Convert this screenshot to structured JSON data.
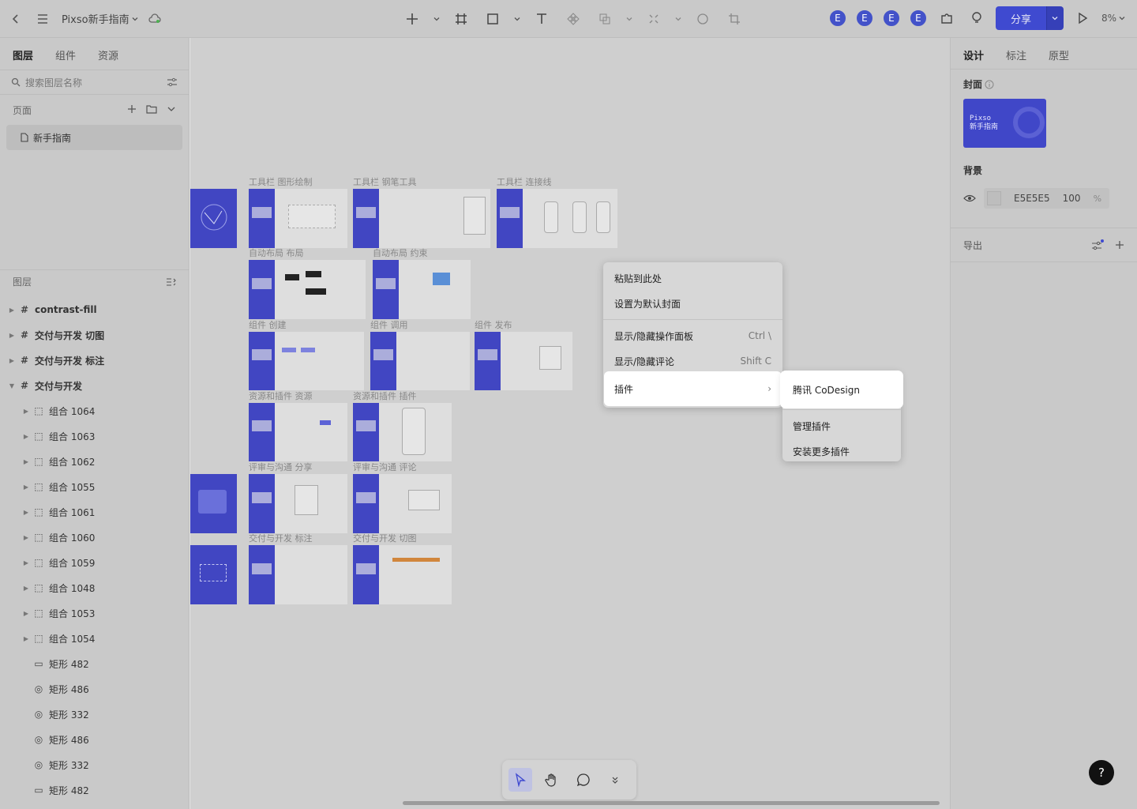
{
  "topbar": {
    "file_title": "Pixso新手指南",
    "avatars": [
      "E",
      "E",
      "E",
      "E"
    ],
    "share_label": "分享",
    "zoom": "8%"
  },
  "left": {
    "tabs": [
      "图层",
      "组件",
      "资源"
    ],
    "search_placeholder": "搜索图层名称",
    "pages_title": "页面",
    "page_item": "新手指南",
    "layers_title": "图层",
    "layers": [
      {
        "label": "contrast-fill",
        "level": 0,
        "kind": "frame"
      },
      {
        "label": "交付与开发 切图",
        "level": 0,
        "kind": "frame"
      },
      {
        "label": "交付与开发 标注",
        "level": 0,
        "kind": "frame"
      },
      {
        "label": "交付与开发",
        "level": 0,
        "kind": "frame",
        "open": true
      },
      {
        "label": "组合 1064",
        "level": 1,
        "kind": "group"
      },
      {
        "label": "组合 1063",
        "level": 1,
        "kind": "group"
      },
      {
        "label": "组合 1062",
        "level": 1,
        "kind": "group"
      },
      {
        "label": "组合 1055",
        "level": 1,
        "kind": "group"
      },
      {
        "label": "组合 1061",
        "level": 1,
        "kind": "group"
      },
      {
        "label": "组合 1060",
        "level": 1,
        "kind": "group"
      },
      {
        "label": "组合 1059",
        "level": 1,
        "kind": "group"
      },
      {
        "label": "组合 1048",
        "level": 1,
        "kind": "group"
      },
      {
        "label": "组合 1053",
        "level": 1,
        "kind": "group"
      },
      {
        "label": "组合 1054",
        "level": 1,
        "kind": "group"
      },
      {
        "label": "矩形 482",
        "level": 2,
        "kind": "rect"
      },
      {
        "label": "矩形 486",
        "level": 2,
        "kind": "ellipse"
      },
      {
        "label": "矩形 332",
        "level": 2,
        "kind": "ellipse"
      },
      {
        "label": "矩形 486",
        "level": 2,
        "kind": "ellipse"
      },
      {
        "label": "矩形 332",
        "level": 2,
        "kind": "ellipse"
      },
      {
        "label": "矩形 482",
        "level": 2,
        "kind": "rect"
      }
    ]
  },
  "canvas": {
    "frame_labels": [
      "工具栏 图形绘制",
      "工具栏 钢笔工具",
      "工具栏 连接线",
      "自动布局 布局",
      "自动布局 约束",
      "组件 创建",
      "组件 调用",
      "组件 发布",
      "资源和插件 资源",
      "资源和插件 插件",
      "评审与沟通 分享",
      "评审与沟通 评论",
      "交付与开发 标注",
      "交付与开发 切图"
    ]
  },
  "context_menu": {
    "items": [
      {
        "label": "粘贴到此处",
        "shortcut": ""
      },
      {
        "label": "设置为默认封面",
        "shortcut": ""
      },
      {
        "label": "显示/隐藏操作面板",
        "shortcut": "Ctrl \\"
      },
      {
        "label": "显示/隐藏评论",
        "shortcut": "Shift C"
      },
      {
        "label": "插件",
        "shortcut": "›"
      }
    ]
  },
  "submenu": {
    "items": [
      "腾讯 CoDesign",
      "管理插件",
      "安装更多插件"
    ]
  },
  "right": {
    "tabs": [
      "设计",
      "标注",
      "原型"
    ],
    "cover_title": "封面",
    "cover_text": "Pixso\n新手指南",
    "background_title": "背景",
    "bg_hex": "E5E5E5",
    "bg_opacity": "100",
    "bg_pct": "%",
    "export_title": "导出"
  },
  "help_label": "?",
  "colors": {
    "accent": "#3f4ad0",
    "frame_blue": "#4146c2",
    "canvas_bg": "#e5e5e5"
  }
}
